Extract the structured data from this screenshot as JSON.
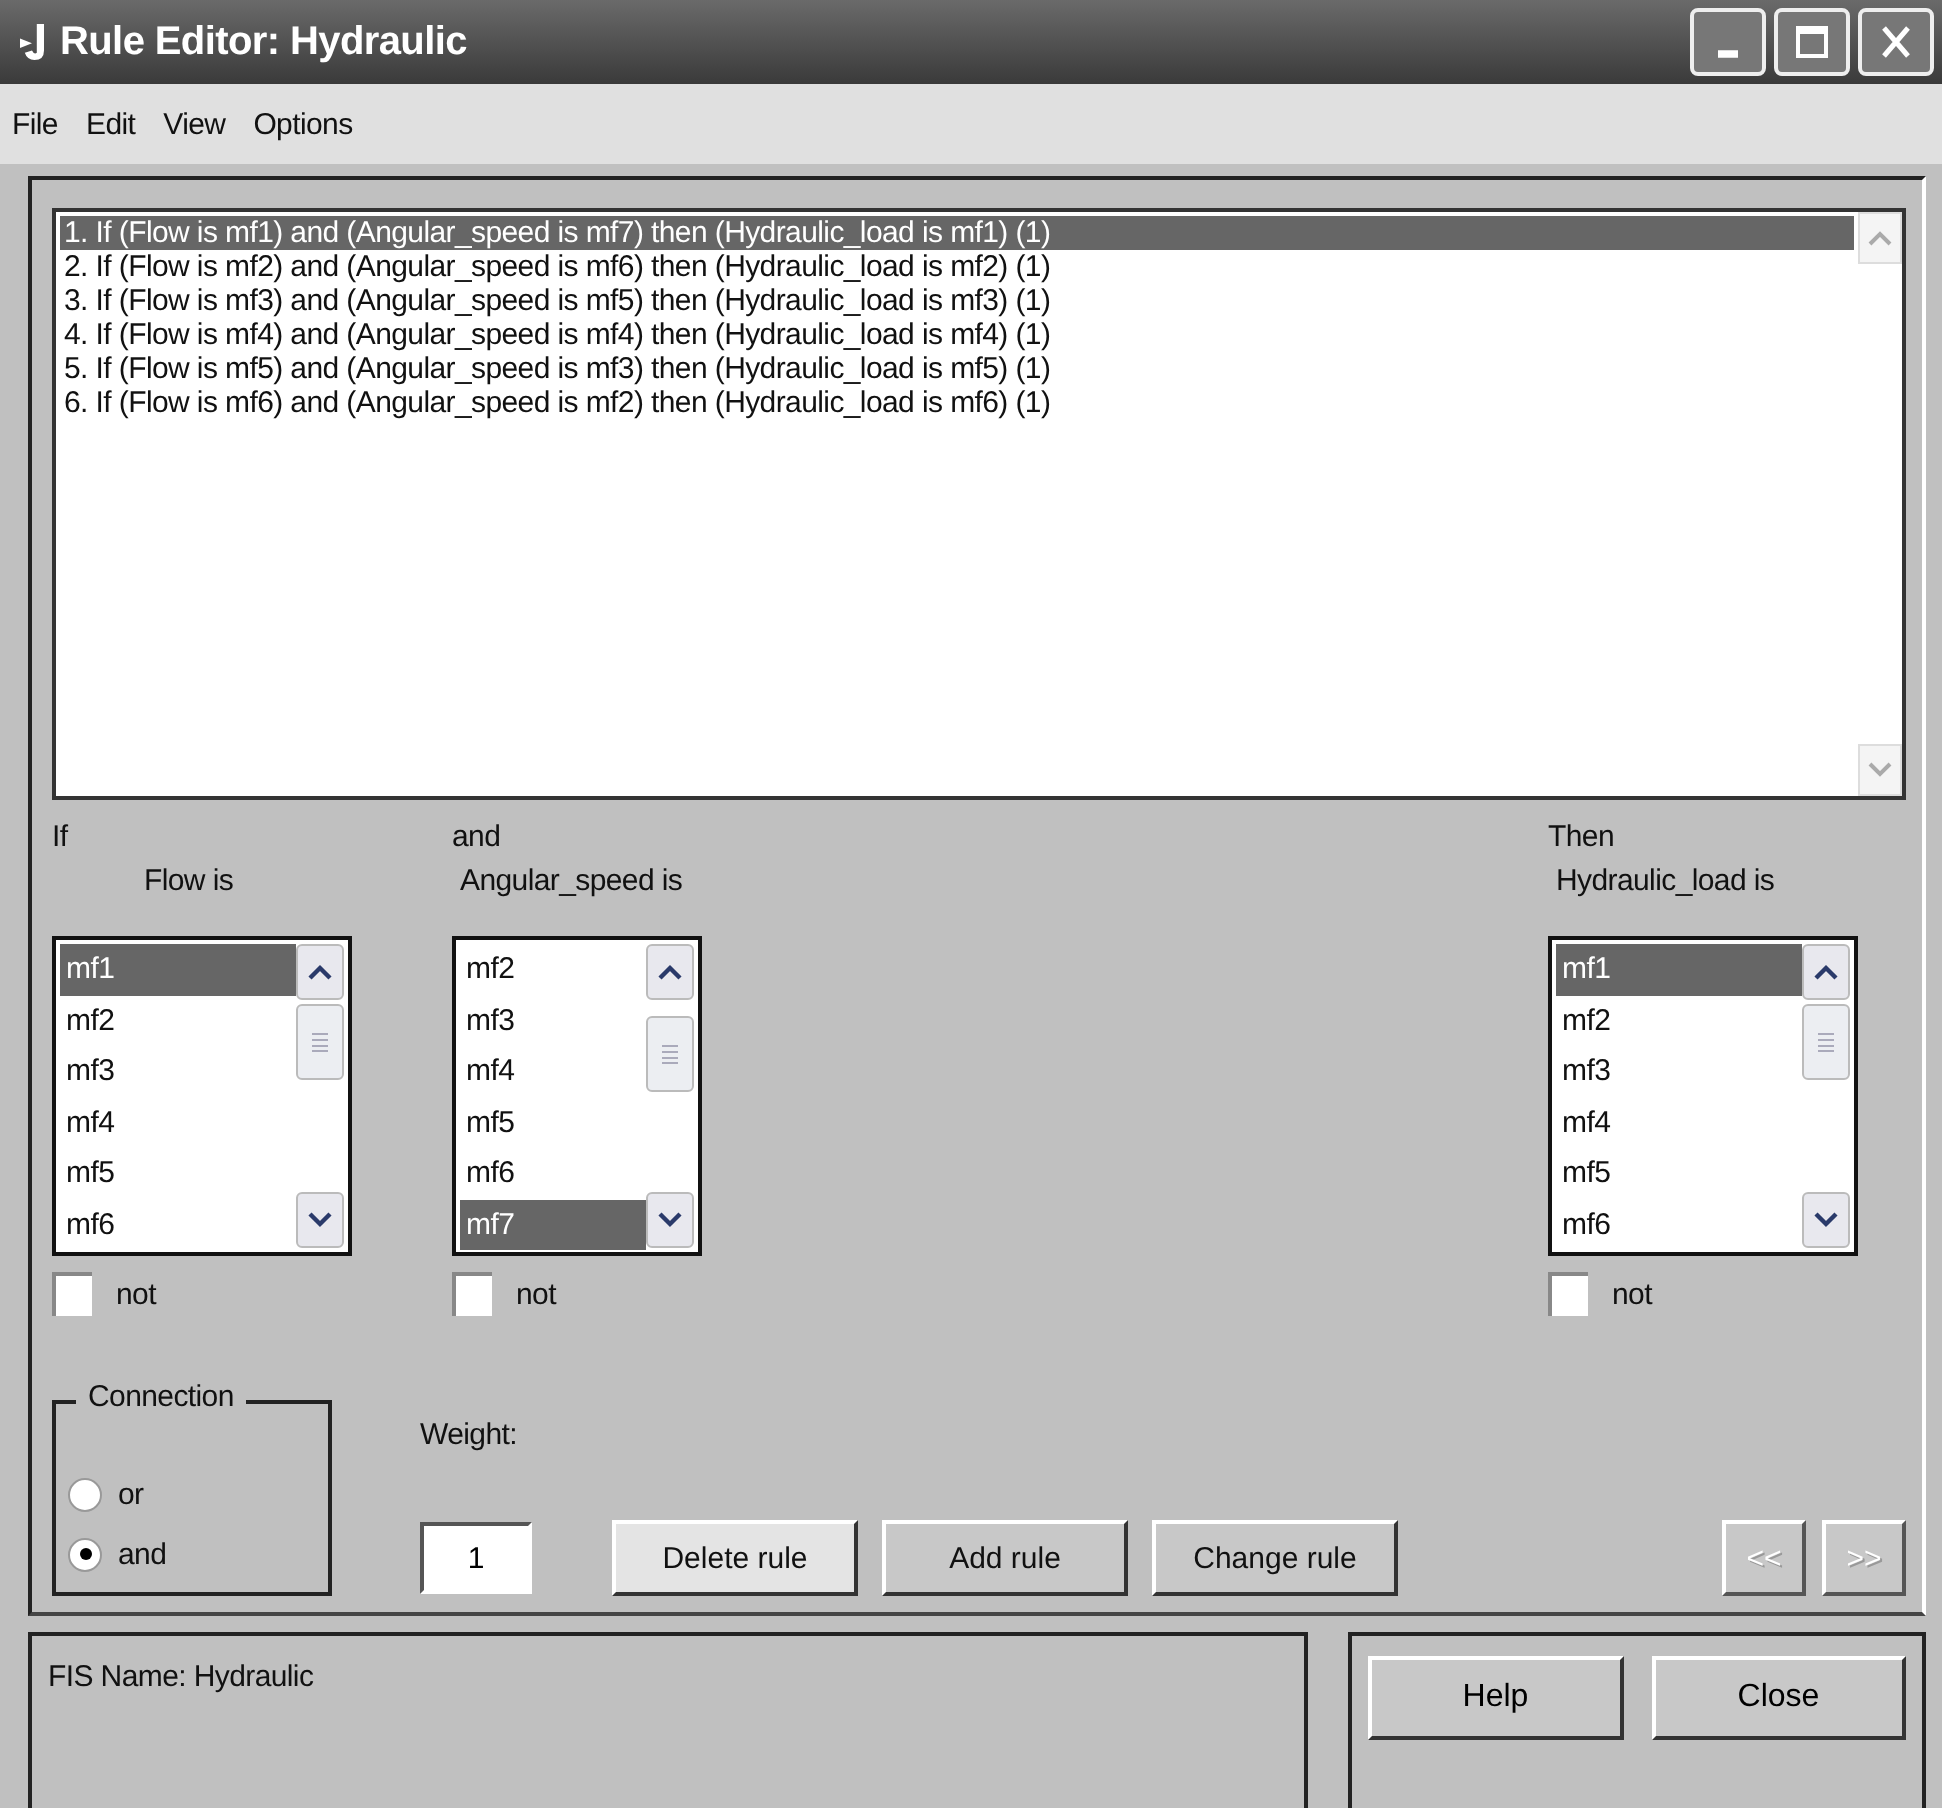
{
  "window": {
    "title": "Rule Editor: Hydraulic"
  },
  "menu": [
    "File",
    "Edit",
    "View",
    "Options"
  ],
  "rules": [
    {
      "text": "1. If (Flow is mf1) and (Angular_speed is mf7) then (Hydraulic_load is mf1) (1)",
      "selected": true
    },
    {
      "text": "2. If (Flow is mf2) and (Angular_speed is mf6) then (Hydraulic_load is mf2) (1)",
      "selected": false
    },
    {
      "text": "3. If (Flow is mf3) and (Angular_speed is mf5) then (Hydraulic_load is mf3) (1)",
      "selected": false
    },
    {
      "text": "4. If (Flow is mf4) and (Angular_speed is mf4) then (Hydraulic_load is mf4) (1)",
      "selected": false
    },
    {
      "text": "5. If (Flow is mf5) and (Angular_speed is mf3) then (Hydraulic_load is mf5) (1)",
      "selected": false
    },
    {
      "text": "6. If (Flow is mf6) and (Angular_speed is mf2) then (Hydraulic_load is mf6) (1)",
      "selected": false
    }
  ],
  "variables": [
    {
      "heading": "If",
      "name": "Flow is",
      "not_label": "not",
      "not_checked": false,
      "items": [
        {
          "label": "mf1",
          "selected": true
        },
        {
          "label": "mf2",
          "selected": false
        },
        {
          "label": "mf3",
          "selected": false
        },
        {
          "label": "mf4",
          "selected": false
        },
        {
          "label": "mf5",
          "selected": false
        },
        {
          "label": "mf6",
          "selected": false
        }
      ]
    },
    {
      "heading": "and",
      "name": "Angular_speed is",
      "not_label": "not",
      "not_checked": false,
      "items": [
        {
          "label": "mf2",
          "selected": false
        },
        {
          "label": "mf3",
          "selected": false
        },
        {
          "label": "mf4",
          "selected": false
        },
        {
          "label": "mf5",
          "selected": false
        },
        {
          "label": "mf6",
          "selected": false
        },
        {
          "label": "mf7",
          "selected": true
        }
      ]
    },
    {
      "heading": "Then",
      "name": "Hydraulic_load is",
      "not_label": "not",
      "not_checked": false,
      "items": [
        {
          "label": "mf1",
          "selected": true
        },
        {
          "label": "mf2",
          "selected": false
        },
        {
          "label": "mf3",
          "selected": false
        },
        {
          "label": "mf4",
          "selected": false
        },
        {
          "label": "mf5",
          "selected": false
        },
        {
          "label": "mf6",
          "selected": false
        }
      ]
    }
  ],
  "connection": {
    "title": "Connection",
    "options": [
      {
        "label": "or",
        "selected": false
      },
      {
        "label": "and",
        "selected": true
      }
    ]
  },
  "weight": {
    "label": "Weight:",
    "value": "1"
  },
  "actions": [
    {
      "label": "Delete rule",
      "disabled": false
    },
    {
      "label": "Add rule",
      "disabled": false
    },
    {
      "label": "Change rule",
      "disabled": false
    }
  ],
  "nav": [
    {
      "label": "<<",
      "disabled": true
    },
    {
      "label": ">>",
      "disabled": true
    }
  ],
  "status": "FIS Name: Hydraulic",
  "footer_buttons": [
    "Help",
    "Close"
  ]
}
